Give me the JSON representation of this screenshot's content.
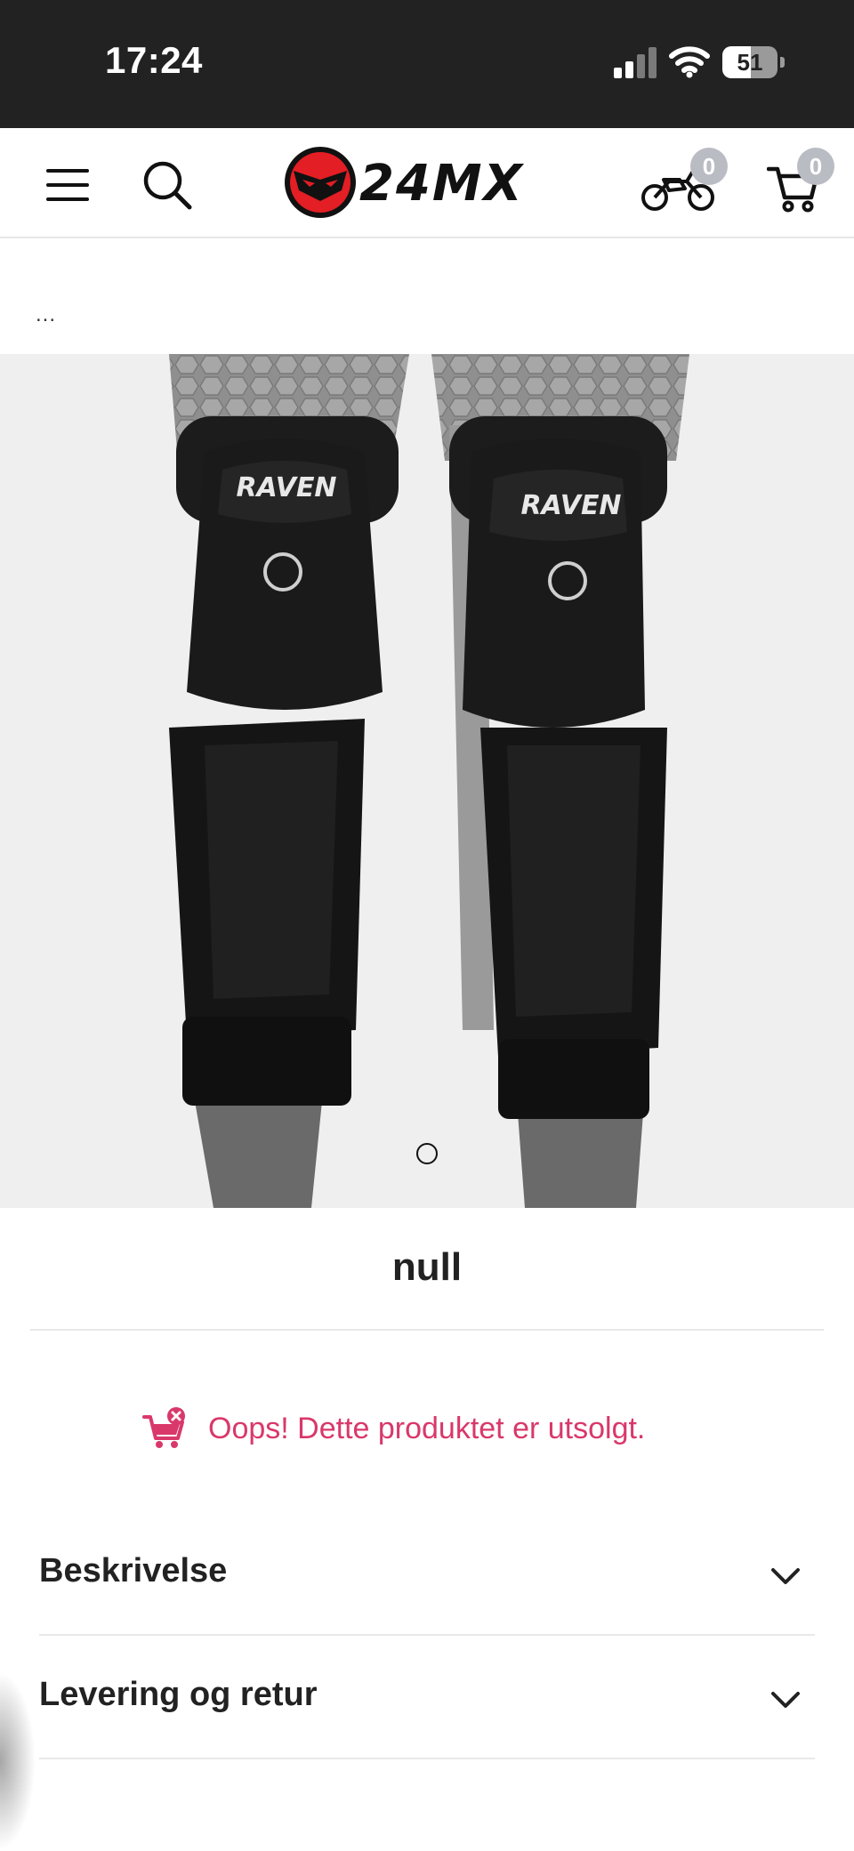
{
  "status_bar": {
    "time": "17:24",
    "battery": "51",
    "battery_level": 0.51
  },
  "header": {
    "logo_text": "24MX",
    "garage_count": "0",
    "cart_count": "0",
    "icons": [
      "menu-icon",
      "search-icon",
      "bike-icon",
      "cart-icon"
    ]
  },
  "breadcrumb": "...",
  "product": {
    "title": "null",
    "image_brand_text": "RAVEN",
    "carousel_total": 1,
    "carousel_active": 1,
    "out_of_stock_message": "Oops! Dette produktet er utsolgt."
  },
  "accordions": [
    {
      "label": "Beskrivelse"
    },
    {
      "label": "Levering og retur"
    }
  ],
  "colors": {
    "status_bar_bg": "#222222",
    "accent_pink": "#d9386a",
    "badge_bg": "#b9bcc2",
    "logo_red": "#e31e24"
  }
}
